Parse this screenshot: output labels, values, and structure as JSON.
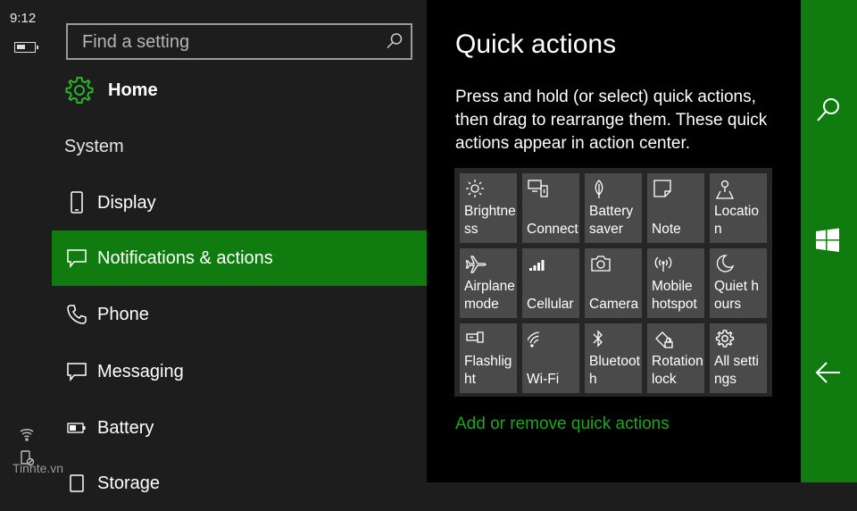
{
  "status_bar": {
    "time": "9:12",
    "icons": [
      "battery-icon",
      "wifi-icon",
      "device-lock-icon"
    ]
  },
  "search": {
    "placeholder": "Find a setting",
    "icon": "search-icon"
  },
  "home": {
    "label": "Home",
    "icon": "gear-icon"
  },
  "section": {
    "title": "System"
  },
  "nav": {
    "items": [
      {
        "label": "Display",
        "icon": "phone-display-icon"
      },
      {
        "label": "Notifications & actions",
        "icon": "notification-icon",
        "selected": true
      },
      {
        "label": "Phone",
        "icon": "phone-handset-icon"
      },
      {
        "label": "Messaging",
        "icon": "message-icon"
      },
      {
        "label": "Battery",
        "icon": "battery-icon"
      },
      {
        "label": "Storage",
        "icon": "storage-icon"
      }
    ]
  },
  "main": {
    "title": "Quick actions",
    "description": "Press and hold (or select) quick actions, then drag to rearrange them. These quick actions appear in action center.",
    "link": "Add or remove quick actions"
  },
  "quick_actions": [
    {
      "label": "Brightness",
      "icon": "brightness-icon"
    },
    {
      "label": "Connect",
      "icon": "connect-icon"
    },
    {
      "label": "Battery saver",
      "icon": "battery-saver-icon"
    },
    {
      "label": "Note",
      "icon": "note-icon"
    },
    {
      "label": "Location",
      "icon": "location-icon"
    },
    {
      "label": "Airplane mode",
      "icon": "airplane-icon"
    },
    {
      "label": "Cellular",
      "icon": "cellular-icon"
    },
    {
      "label": "Camera",
      "icon": "camera-icon"
    },
    {
      "label": "Mobile hotspot",
      "icon": "hotspot-icon"
    },
    {
      "label": "Quiet hours",
      "icon": "moon-icon"
    },
    {
      "label": "Flashlight",
      "icon": "flashlight-icon"
    },
    {
      "label": "Wi-Fi",
      "icon": "wifi-icon"
    },
    {
      "label": "Bluetooth",
      "icon": "bluetooth-icon"
    },
    {
      "label": "Rotation lock",
      "icon": "rotation-lock-icon"
    },
    {
      "label": "All settings",
      "icon": "settings-icon"
    }
  ],
  "right_bar": {
    "icons": [
      "search-icon",
      "windows-start-icon",
      "back-arrow-icon"
    ]
  },
  "watermark": "Tinhte.vn",
  "colors": {
    "accent": "#107c10",
    "link": "#1fa71f",
    "tile": "#4a4a4a",
    "background": "#1d1d1d"
  }
}
